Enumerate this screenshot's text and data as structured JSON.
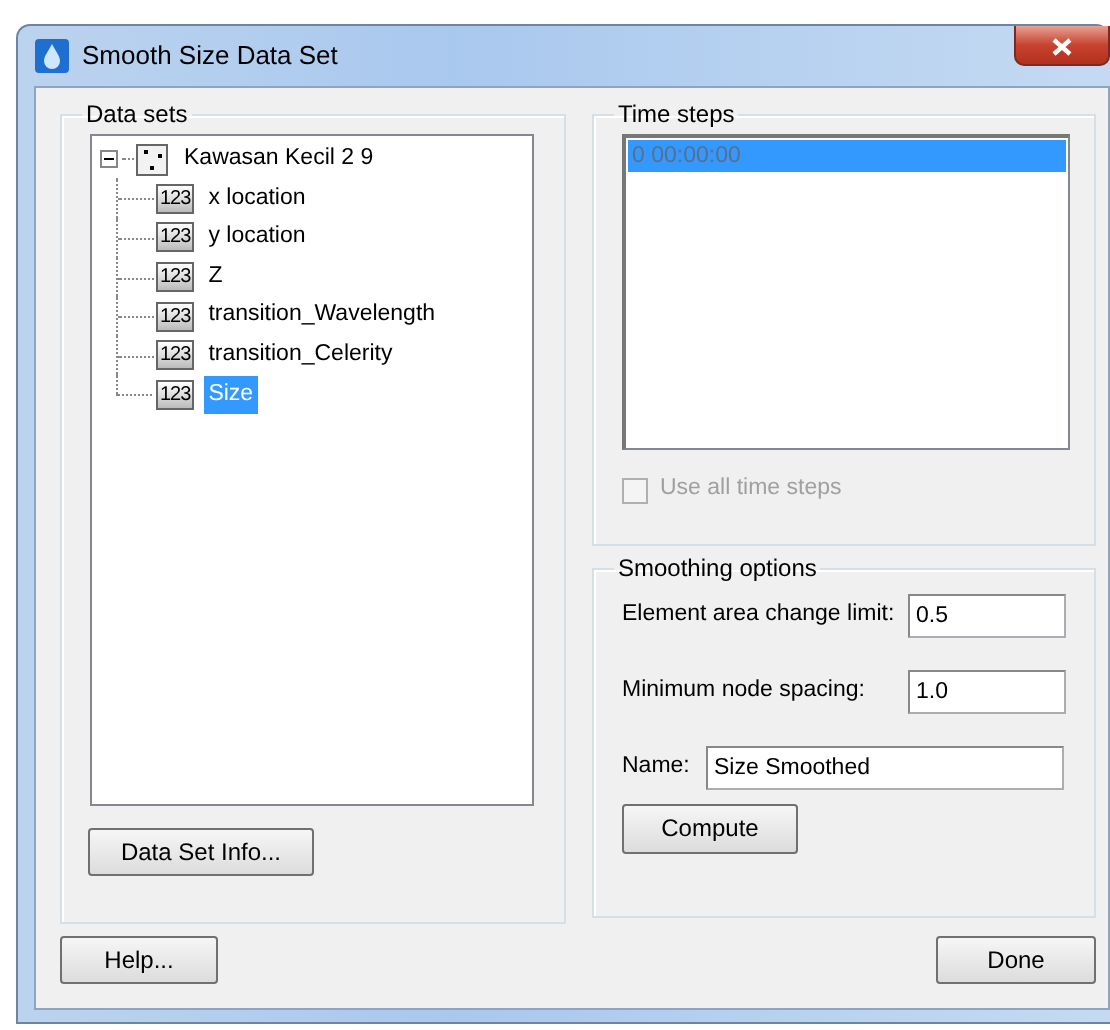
{
  "window": {
    "title": "Smooth Size Data Set"
  },
  "data_sets": {
    "label": "Data sets",
    "tree": [
      {
        "label": "Kawasan Kecil 2 9",
        "kind": "scatter",
        "expanded": true,
        "selected": false,
        "children": [
          {
            "label": "x location",
            "kind": "scalar",
            "badge": "123",
            "selected": false
          },
          {
            "label": "y location",
            "kind": "scalar",
            "badge": "123",
            "selected": false
          },
          {
            "label": "Z",
            "kind": "scalar",
            "badge": "123",
            "selected": false
          },
          {
            "label": "transition_Wavelength",
            "kind": "scalar",
            "badge": "123",
            "selected": false
          },
          {
            "label": "transition_Celerity",
            "kind": "scalar",
            "badge": "123",
            "selected": false
          },
          {
            "label": "Size",
            "kind": "scalar",
            "badge": "123",
            "selected": true
          }
        ]
      }
    ],
    "info_button": "Data Set Info..."
  },
  "time_steps": {
    "label": "Time steps",
    "disabled": true,
    "items": [
      {
        "label": "0 00:00:00",
        "selected": true
      }
    ],
    "use_all": {
      "label": "Use all time steps",
      "checked": false,
      "disabled": true
    }
  },
  "smoothing": {
    "label": "Smoothing options",
    "fields": [
      {
        "label": "Element area change limit:",
        "value": "0.5",
        "kind": "short"
      },
      {
        "label": "Minimum node spacing:",
        "value": "1.0",
        "kind": "short"
      },
      {
        "label": "Name:",
        "value": "Size Smoothed",
        "kind": "wide"
      }
    ],
    "compute_button": "Compute"
  },
  "buttons": [
    {
      "label": "Help...",
      "kind": "left"
    },
    {
      "label": "Done",
      "kind": "right"
    }
  ]
}
